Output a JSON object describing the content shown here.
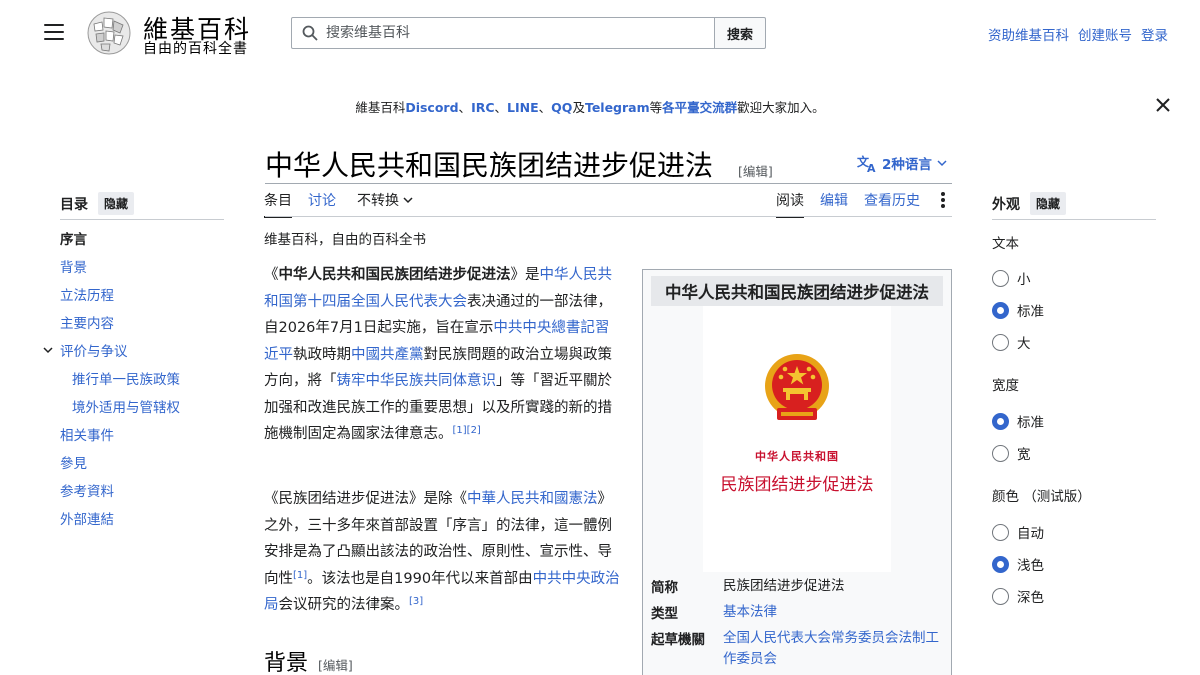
{
  "header": {
    "logo_title": "維基百科",
    "logo_tagline": "自由的百科全書",
    "search_placeholder": "搜索维基百科",
    "search_button": "搜索",
    "user_links": [
      "资助维基百科",
      "创建账号",
      "登录"
    ]
  },
  "notice": {
    "prefix": "維基百科",
    "links": [
      "Discord",
      "IRC",
      "LINE",
      "QQ",
      "Telegram"
    ],
    "sep1": "、",
    "sep2": "、",
    "sep3": "、",
    "and": "及",
    "mid": "等",
    "mid_link": "各平臺交流群",
    "suffix": "歡迎大家加入。"
  },
  "page": {
    "title": "中华人民共和国民族团结进步促进法",
    "title_edit": "[编辑]",
    "languages": "2种语言",
    "tabs": {
      "article": "条目",
      "talk": "讨论",
      "variant": "不转换",
      "read": "阅读",
      "edit": "编辑",
      "history": "查看历史"
    },
    "site_sub": "维基百科，自由的百科全书"
  },
  "toc": {
    "title": "目录",
    "hide": "隐藏",
    "items": [
      {
        "label": "序言"
      },
      {
        "label": "背景"
      },
      {
        "label": "立法历程"
      },
      {
        "label": "主要内容"
      },
      {
        "label": "评价与争议"
      },
      {
        "label": "推行单一民族政策"
      },
      {
        "label": "境外适用与管辖权"
      },
      {
        "label": "相关事件"
      },
      {
        "label": "參見"
      },
      {
        "label": "参考資料"
      },
      {
        "label": "外部連結"
      }
    ]
  },
  "article": {
    "p1": {
      "t1": "《",
      "b1": "中华人民共和国民族团结进步促进法",
      "t2": "》是",
      "l1": "中华人民共和国第十四届全国人民代表大会",
      "t3": "表决通过的一部法律，自2026年7月1日起实施，旨在宣示",
      "l2": "中共中央總書記",
      "l3": "習近平",
      "t4": "執政時期",
      "l4": "中國共產黨",
      "t5": "對民族問題的政治立場與政策方向，將「",
      "l5": "铸牢中华民族共同体意识",
      "t6": "」等「習近平關於加强和改進民族工作的重要思想」以及所實踐的新的措施機制固定為國家法律意志。",
      "ref1": "[1]",
      "ref2": "[2]"
    },
    "p2": {
      "t1": "《民族团结进步促进法》是除《",
      "l1": "中華人民共和國憲法",
      "t2": "》之外，三十多年來首部設置「序言」的法律，這一體例安排是為了凸顯出該法的政治性、原則性、宣示性、导向性",
      "ref1": "[1]",
      "t3": "。该法也是自1990年代以来首部由",
      "l2": "中共中央政治局",
      "t4": "会议研究的法律案。",
      "ref2": "[3]"
    },
    "h_background": "背景",
    "h_background_edit": "[编辑]"
  },
  "infobox": {
    "title": "中华人民共和国民族团结进步促进法",
    "cover_sub": "中华人民共和国",
    "cover_main": "民族团结进步促进法",
    "rows": [
      {
        "label": "简称",
        "value": "民族团结进步促进法"
      },
      {
        "label": "类型",
        "value": "基本法律"
      },
      {
        "label": "起草機關",
        "value": "全国人民代表大会常务委员会法制工作委员会"
      }
    ]
  },
  "appearance": {
    "title": "外观",
    "hide": "隐藏",
    "text_label": "文本",
    "text_options": [
      "小",
      "标准",
      "大"
    ],
    "width_label": "宽度",
    "width_options": [
      "标准",
      "宽"
    ],
    "color_label": "颜色 （测试版）",
    "color_options": [
      "自动",
      "浅色",
      "深色"
    ],
    "selected": {
      "text": "标准",
      "width": "标准",
      "color": "浅色"
    }
  },
  "colors": {
    "link": "#3366cc",
    "text": "#202122",
    "cover_red": "#c8102e"
  }
}
